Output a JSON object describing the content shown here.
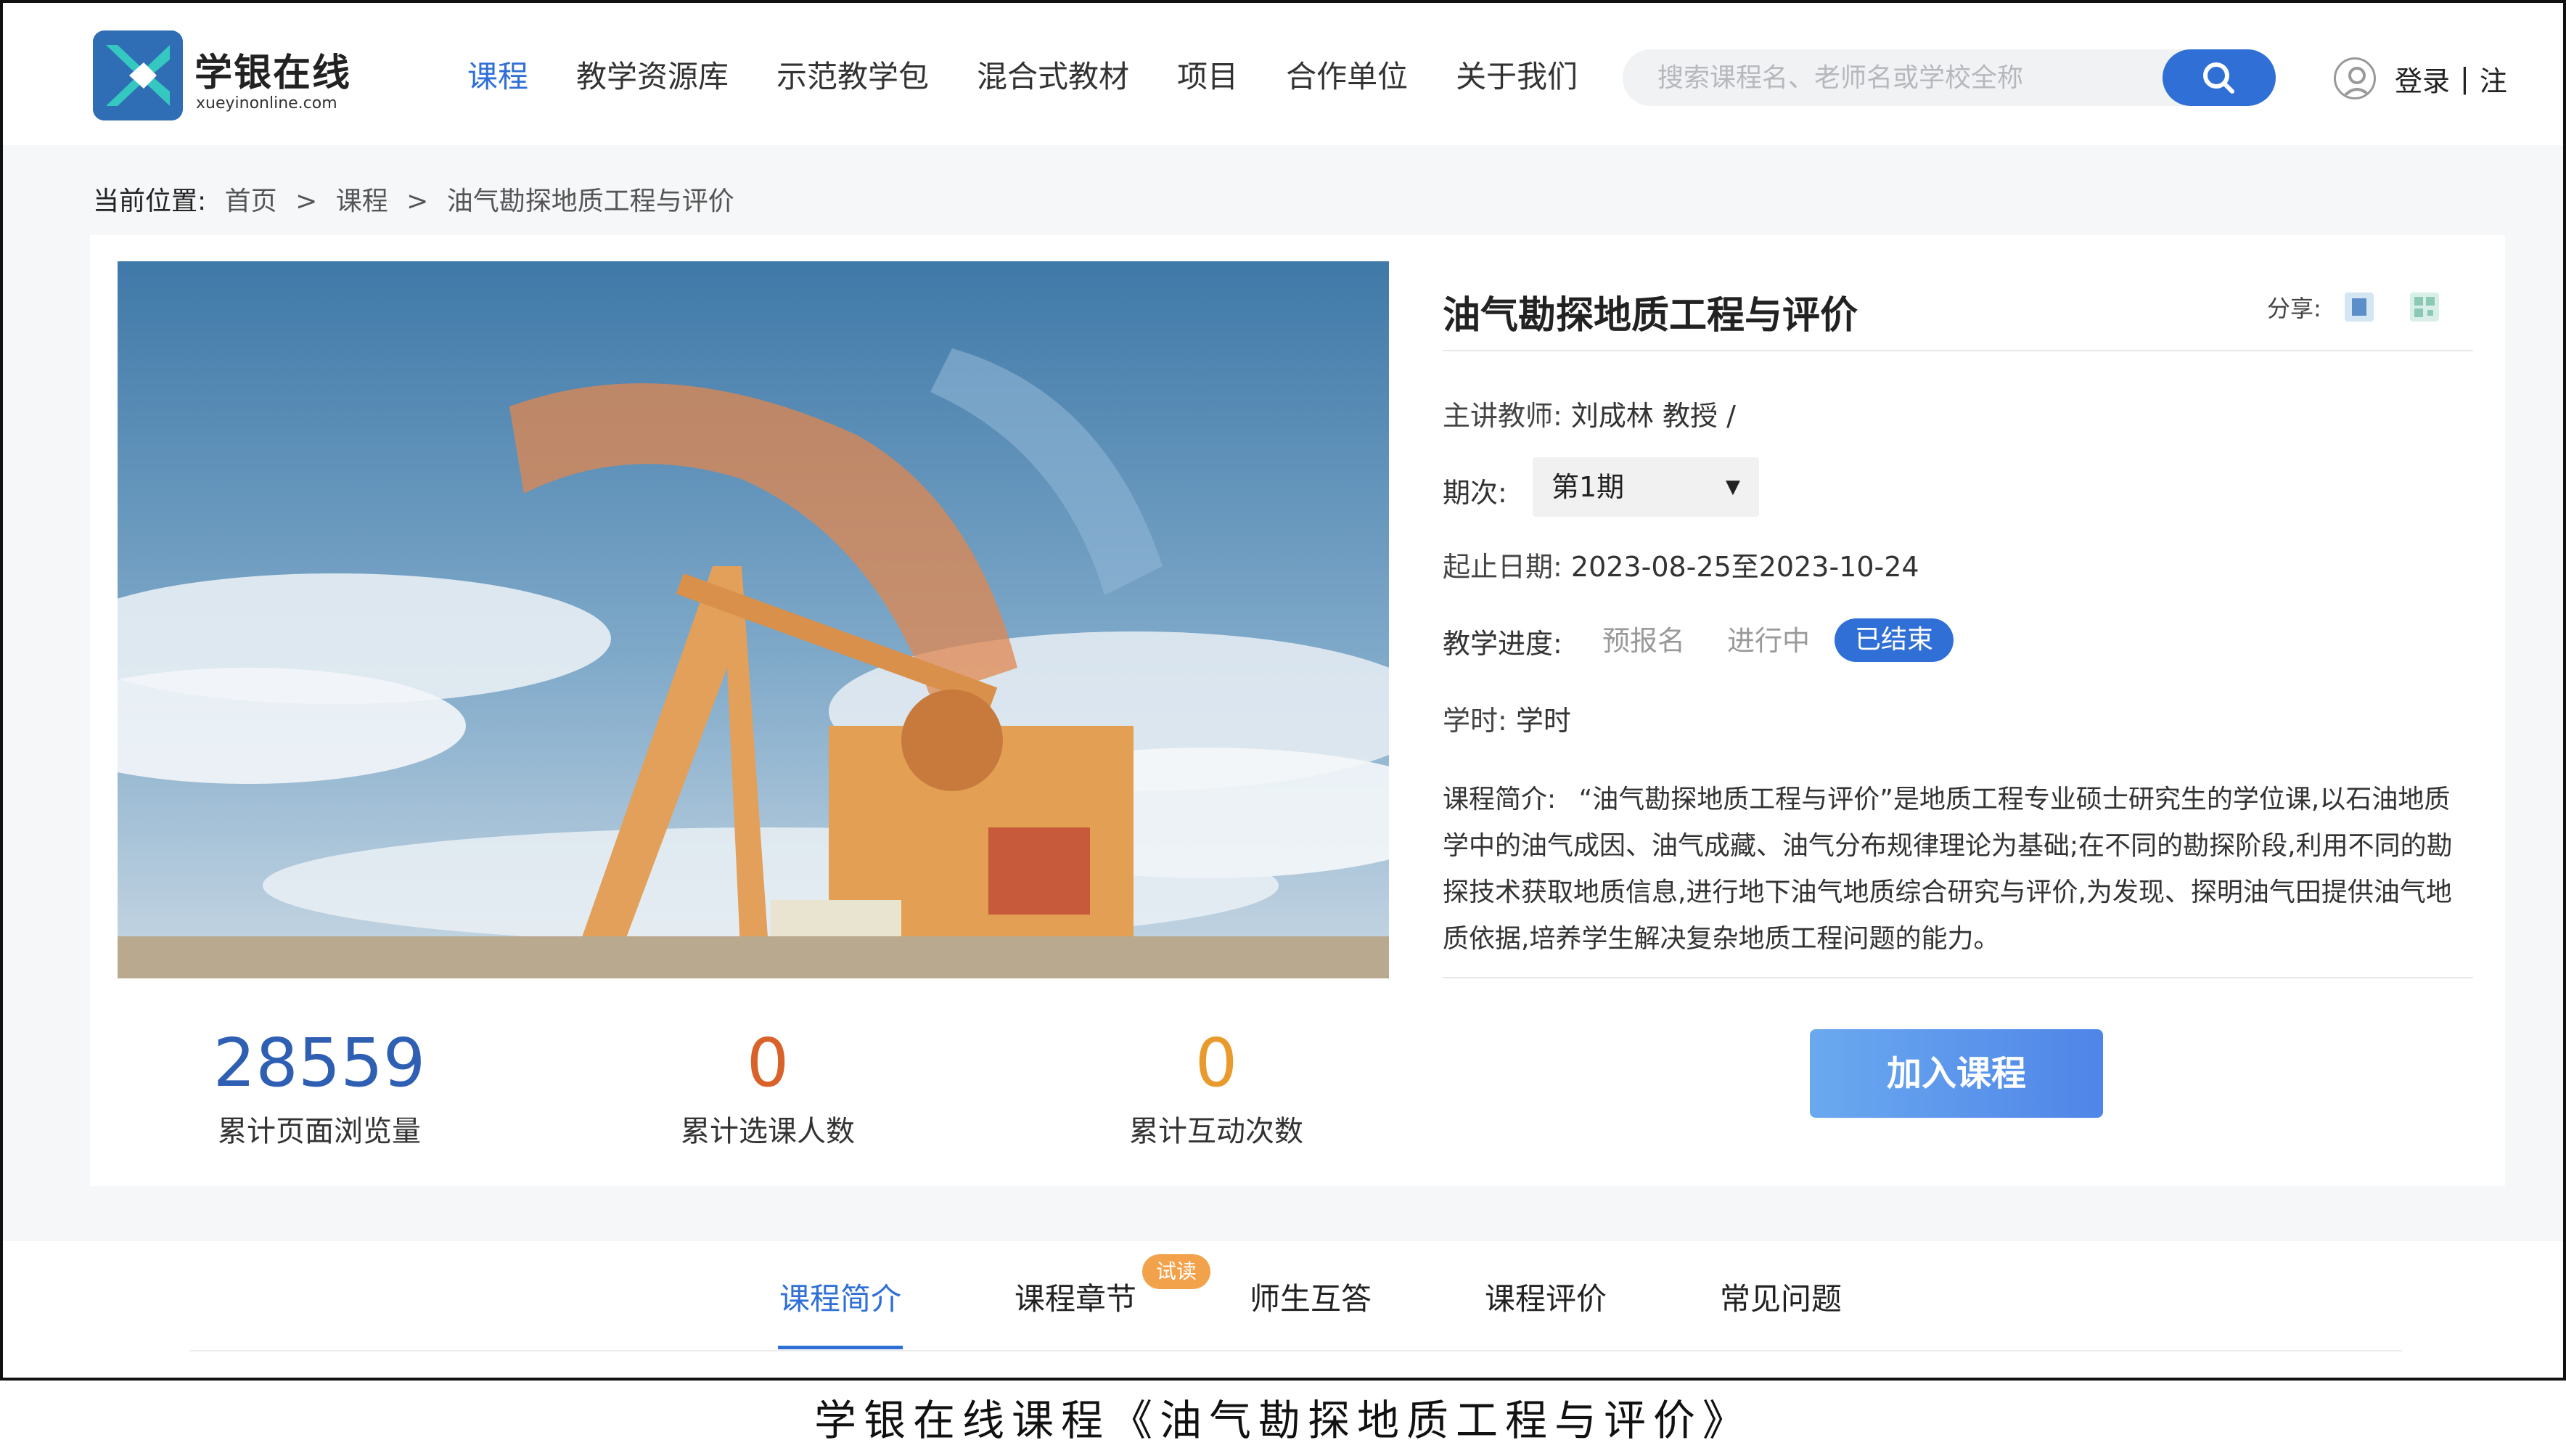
{
  "logo": {
    "name": "学银在线",
    "domain": "xueyinonline.com"
  },
  "nav": {
    "items": [
      {
        "label": "课程",
        "active": true
      },
      {
        "label": "教学资源库"
      },
      {
        "label": "示范教学包"
      },
      {
        "label": "混合式教材"
      },
      {
        "label": "项目"
      },
      {
        "label": "合作单位"
      },
      {
        "label": "关于我们"
      }
    ]
  },
  "search": {
    "placeholder": "搜索课程名、老师名或学校全称"
  },
  "user": {
    "login": "登录",
    "separator": "|",
    "register": "注"
  },
  "breadcrumb": {
    "label": "当前位置:",
    "home": "首页",
    "courses": "课程",
    "current": "油气勘探地质工程与评价",
    "sep": ">"
  },
  "course": {
    "title": "油气勘探地质工程与评价",
    "share_label": "分享:",
    "teacher_label": "主讲教师:",
    "teacher": "刘成林 教授 /",
    "term_label": "期次:",
    "term_value": "第1期",
    "dates_label": "起止日期:",
    "dates": "2023-08-25至2023-10-24",
    "progress_label": "教学进度:",
    "stages": [
      "预报名",
      "进行中",
      "已结束"
    ],
    "active_stage": "已结束",
    "hours_label": "学时:",
    "hours": "学时",
    "intro_label": "课程简介:",
    "intro": "“油气勘探地质工程与评价”是地质工程专业硕士研究生的学位课,以石油地质学中的油气成因、油气成藏、油气分布规律理论为基础;在不同的勘探阶段,利用不同的勘探技术获取地质信息,进行地下油气地质综合研究与评价,为发现、探明油气田提供油气地质依据,培养学生解决复杂地质工程问题的能力。",
    "join_label": "加入课程"
  },
  "stats": [
    {
      "value": "28559",
      "label": "累计页面浏览量",
      "color": "#2f5fb3"
    },
    {
      "value": "0",
      "label": "累计选课人数",
      "color": "#d9622b"
    },
    {
      "value": "0",
      "label": "累计互动次数",
      "color": "#e89a2c"
    }
  ],
  "tabs": {
    "items": [
      "课程简介",
      "课程章节",
      "师生互答",
      "课程评价",
      "常见问题"
    ],
    "active": "课程简介",
    "badge": "试读"
  },
  "caption": "学银在线课程《油气勘探地质工程与评价》",
  "colors": {
    "accent": "#2f6fd6",
    "badge": "#f2a24a"
  }
}
